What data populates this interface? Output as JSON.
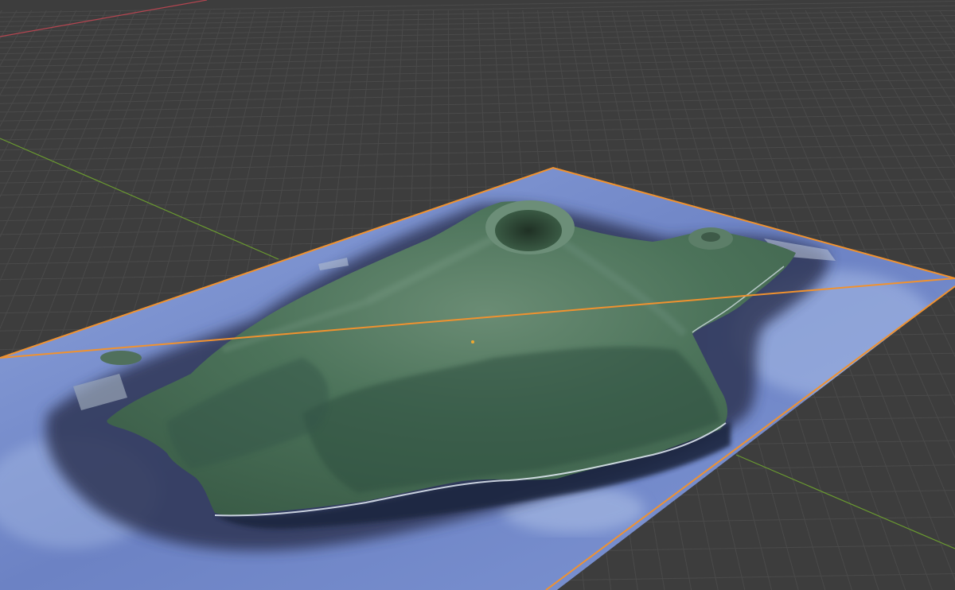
{
  "viewport": {
    "mode": "3d-viewport",
    "background_color": "#3d3d3d",
    "grid_line_color": "#4a4a4a",
    "x_axis_color": "#b34550",
    "y_axis_color": "#6a9a30",
    "selection_outline_color": "#f0922f",
    "origin_color": "#f0a830"
  },
  "object": {
    "kind": "terrain-plane",
    "selected": true,
    "land_color": "#4a7258",
    "ridge_color": "#5d806a",
    "valley_color": "#2f5040",
    "shallow_water_color": "#2c3450",
    "sea_color": "#6a80c0",
    "sea_light_color": "#9eb2e0",
    "crater_color": "#263a2c"
  }
}
